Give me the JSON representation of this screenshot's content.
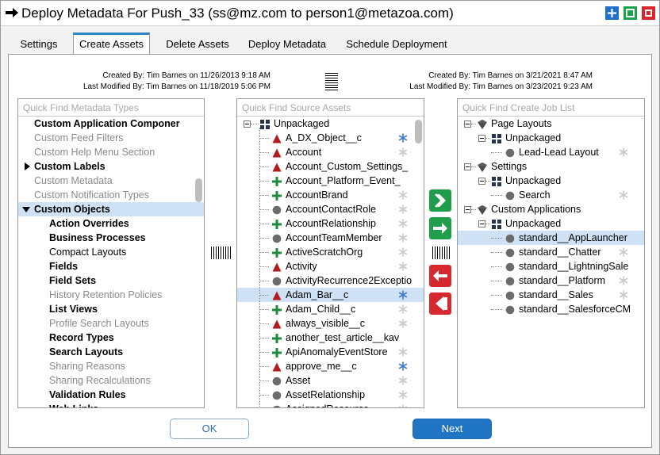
{
  "title": "Deploy Metadata For Push_33 (ss@mz.com to person1@metazoa.com)",
  "tabs": [
    "Settings",
    "Create Assets",
    "Delete Assets",
    "Deploy Metadata",
    "Schedule Deployment"
  ],
  "left_meta": {
    "created": "Created By: Tim Barnes on 11/26/2013 9:18 AM",
    "modified": "Last Modified By: Tim Barnes on 11/18/2019 5:06 PM"
  },
  "right_meta": {
    "created": "Created By: Tim Barnes on 3/21/2021 8:47 AM",
    "modified": "Last Modified By: Tim Barnes on 3/23/2021 9:23 AM"
  },
  "types_panel": {
    "placeholder": "Quick Find Metadata Types",
    "items": [
      {
        "label": "Custom Application Componer",
        "style": "bold",
        "indent": 0
      },
      {
        "label": "Custom Feed Filters",
        "style": "gray",
        "indent": 0
      },
      {
        "label": "Custom Help Menu Section",
        "style": "gray",
        "indent": 0
      },
      {
        "label": "Custom Labels",
        "style": "bold",
        "indent": 0,
        "arrow": "right"
      },
      {
        "label": "Custom Metadata",
        "style": "gray",
        "indent": 0
      },
      {
        "label": "Custom Notification Types",
        "style": "gray",
        "indent": 0
      },
      {
        "label": "Custom Objects",
        "style": "bold",
        "indent": 0,
        "arrow": "down",
        "selected": true
      },
      {
        "label": "Action Overrides",
        "style": "bold",
        "indent": 1
      },
      {
        "label": "Business Processes",
        "style": "bold",
        "indent": 1
      },
      {
        "label": "Compact Layouts",
        "style": "normal",
        "indent": 1
      },
      {
        "label": "Fields",
        "style": "bold",
        "indent": 1
      },
      {
        "label": "Field Sets",
        "style": "bold",
        "indent": 1
      },
      {
        "label": "History Retention Policies",
        "style": "gray",
        "indent": 1
      },
      {
        "label": "List Views",
        "style": "bold",
        "indent": 1
      },
      {
        "label": "Profile Search Layouts",
        "style": "gray",
        "indent": 1
      },
      {
        "label": "Record Types",
        "style": "bold",
        "indent": 1
      },
      {
        "label": "Search Layouts",
        "style": "bold",
        "indent": 1
      },
      {
        "label": "Sharing Reasons",
        "style": "gray",
        "indent": 1
      },
      {
        "label": "Sharing Recalculations",
        "style": "gray",
        "indent": 1
      },
      {
        "label": "Validation Rules",
        "style": "bold",
        "indent": 1
      },
      {
        "label": "Web Links",
        "style": "bold",
        "indent": 1
      }
    ]
  },
  "source_panel": {
    "placeholder": "Quick Find Source Assets",
    "root": "Unpackaged",
    "items": [
      {
        "label": "A_DX_Object__c",
        "icon": "triangle-red",
        "star": "blue"
      },
      {
        "label": "Account",
        "icon": "triangle-red",
        "star": "gray"
      },
      {
        "label": "Account_Custom_Settings_",
        "icon": "triangle-red",
        "star": ""
      },
      {
        "label": "Account_Platform_Event_",
        "icon": "plus-green",
        "star": ""
      },
      {
        "label": "AccountBrand",
        "icon": "plus-green",
        "star": "gray"
      },
      {
        "label": "AccountContactRole",
        "icon": "circle-gray",
        "star": "gray"
      },
      {
        "label": "AccountRelationship",
        "icon": "plus-green",
        "star": "gray"
      },
      {
        "label": "AccountTeamMember",
        "icon": "circle-gray",
        "star": "gray"
      },
      {
        "label": "ActiveScratchOrg",
        "icon": "plus-green",
        "star": "gray"
      },
      {
        "label": "Activity",
        "icon": "triangle-red",
        "star": "gray"
      },
      {
        "label": "ActivityRecurrence2Exceptio",
        "icon": "circle-gray",
        "star": ""
      },
      {
        "label": "Adam_Bar__c",
        "icon": "triangle-red",
        "star": "blue",
        "selected": true
      },
      {
        "label": "Adam_Child__c",
        "icon": "plus-green",
        "star": "gray"
      },
      {
        "label": "always_visible__c",
        "icon": "triangle-red",
        "star": "gray"
      },
      {
        "label": "another_test_article__kav",
        "icon": "plus-green",
        "star": ""
      },
      {
        "label": "ApiAnomalyEventStore",
        "icon": "plus-green",
        "star": "gray"
      },
      {
        "label": "approve_me__c",
        "icon": "triangle-red",
        "star": "blue"
      },
      {
        "label": "Asset",
        "icon": "circle-gray",
        "star": "gray"
      },
      {
        "label": "AssetRelationship",
        "icon": "circle-gray",
        "star": "gray"
      },
      {
        "label": "AssignedResource",
        "icon": "circle-gray",
        "star": "gray"
      }
    ]
  },
  "job_panel": {
    "placeholder": "Quick Find Create Job List",
    "items": [
      {
        "label": "Page Layouts",
        "icon": "funnel",
        "depth": 0
      },
      {
        "label": "Unpackaged",
        "icon": "package",
        "depth": 1
      },
      {
        "label": "Lead-Lead Layout",
        "icon": "circle-gray",
        "depth": 2,
        "star": true
      },
      {
        "label": "Settings",
        "icon": "funnel",
        "depth": 0
      },
      {
        "label": "Unpackaged",
        "icon": "package",
        "depth": 1
      },
      {
        "label": "Search",
        "icon": "circle-gray",
        "depth": 2,
        "star": true
      },
      {
        "label": "Custom Applications",
        "icon": "funnel",
        "depth": 0
      },
      {
        "label": "Unpackaged",
        "icon": "package",
        "depth": 1
      },
      {
        "label": "standard__AppLauncher",
        "icon": "circle-gray",
        "depth": 2,
        "selected": true
      },
      {
        "label": "standard__Chatter",
        "icon": "circle-gray",
        "depth": 2,
        "star": true
      },
      {
        "label": "standard__LightningSale",
        "icon": "circle-gray",
        "depth": 2
      },
      {
        "label": "standard__Platform",
        "icon": "circle-gray",
        "depth": 2,
        "star": true
      },
      {
        "label": "standard__Sales",
        "icon": "circle-gray",
        "depth": 2,
        "star": true
      },
      {
        "label": "standard__SalesforceCM",
        "icon": "circle-gray",
        "depth": 2
      }
    ]
  },
  "buttons": {
    "ok": "OK",
    "next": "Next"
  },
  "colors": {
    "accent": "#1f74c4",
    "green": "#1e9e4a",
    "red": "#d6282f",
    "selection": "#cfe2f5"
  }
}
